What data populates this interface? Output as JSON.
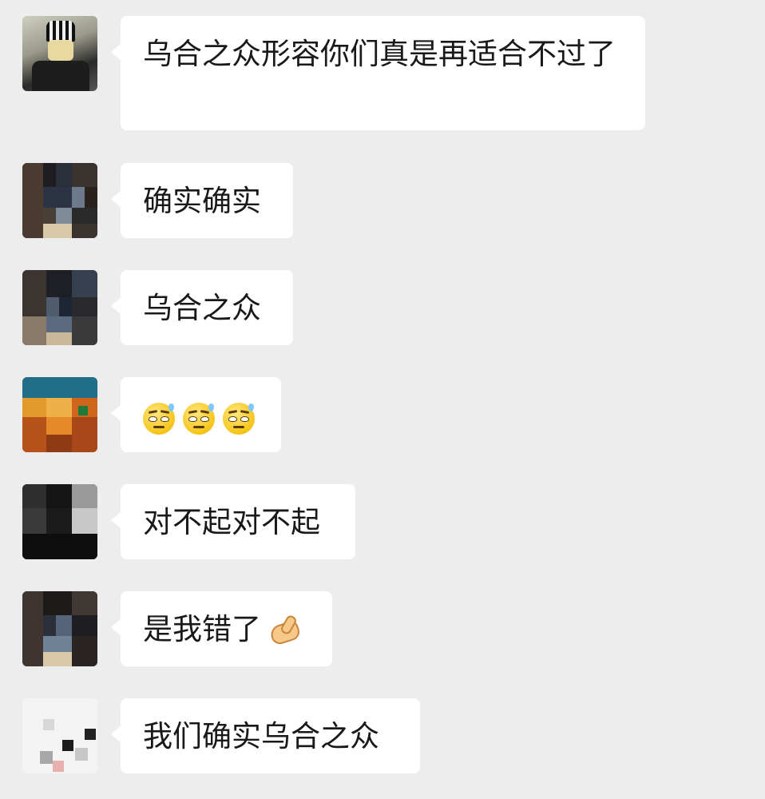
{
  "messages": [
    {
      "text": "乌合之众形容你们真是再适合不过了",
      "avatar_icon": "anime-character-avatar-icon"
    },
    {
      "text": "确实确实",
      "avatar_icon": "pixelated-avatar-icon"
    },
    {
      "text": "乌合之众",
      "avatar_icon": "pixelated-avatar-icon"
    },
    {
      "text": "",
      "emoji": [
        "sweat-smile-emoji",
        "sweat-smile-emoji",
        "sweat-smile-emoji"
      ],
      "avatar_icon": "pixelated-orange-avatar-icon"
    },
    {
      "text": "对不起对不起",
      "avatar_icon": "pixelated-avatar-icon"
    },
    {
      "text": "是我错了",
      "emoji": [
        "ok-hand-emoji"
      ],
      "avatar_icon": "pixelated-avatar-icon"
    },
    {
      "text": "我们确实乌合之众",
      "avatar_icon": "pixelated-white-avatar-icon"
    }
  ],
  "colors": {
    "background": "#ededed",
    "bubble": "#ffffff",
    "text": "#191919"
  }
}
